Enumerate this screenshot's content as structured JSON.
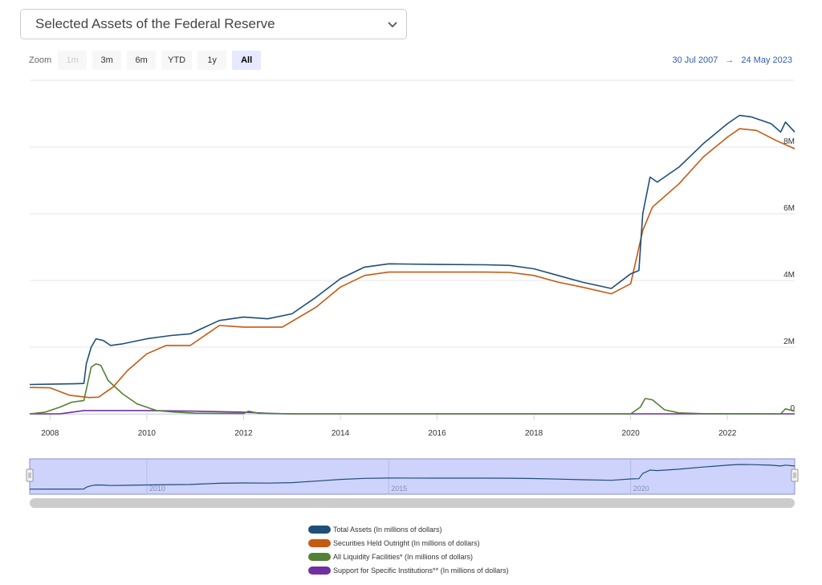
{
  "header": {
    "dropdown_label": "Selected Assets of the Federal Reserve"
  },
  "zoom": {
    "label": "Zoom",
    "buttons": [
      {
        "label": "1m",
        "state": "disabled"
      },
      {
        "label": "3m",
        "state": "normal"
      },
      {
        "label": "6m",
        "state": "normal"
      },
      {
        "label": "YTD",
        "state": "normal"
      },
      {
        "label": "1y",
        "state": "normal"
      },
      {
        "label": "All",
        "state": "active"
      }
    ]
  },
  "range": {
    "from": "30 Jul 2007",
    "arrow": "→",
    "to": "24 May 2023"
  },
  "colors": {
    "total": "#1f4e79",
    "securities": "#c55a11",
    "liquidity": "#538135",
    "support": "#7030a0",
    "navigator_fill": "#cdd3fb",
    "navigator_border": "#8591d6",
    "scrollbar": "#cccccc"
  },
  "chart_data": {
    "type": "line",
    "x_axis": {
      "range": [
        2007.58,
        2023.39
      ],
      "ticks": [
        "2008",
        "2010",
        "2012",
        "2014",
        "2016",
        "2018",
        "2020",
        "2022"
      ]
    },
    "y_axis": {
      "range": [
        0,
        10000000
      ],
      "ticks": [
        "0",
        "2M",
        "4M",
        "6M",
        "8M"
      ]
    },
    "navigator_ticks": [
      "2010",
      "2015",
      "2020"
    ],
    "series": [
      {
        "key": "total",
        "name": "Total Assets (In millions of dollars)",
        "points": [
          [
            2007.58,
            880000
          ],
          [
            2008.0,
            890000
          ],
          [
            2008.5,
            900000
          ],
          [
            2008.7,
            910000
          ],
          [
            2008.75,
            1500000
          ],
          [
            2008.85,
            2000000
          ],
          [
            2008.95,
            2250000
          ],
          [
            2009.1,
            2200000
          ],
          [
            2009.25,
            2050000
          ],
          [
            2009.5,
            2100000
          ],
          [
            2010.0,
            2250000
          ],
          [
            2010.5,
            2350000
          ],
          [
            2010.9,
            2400000
          ],
          [
            2011.5,
            2800000
          ],
          [
            2012.0,
            2900000
          ],
          [
            2012.5,
            2850000
          ],
          [
            2013.0,
            3000000
          ],
          [
            2013.5,
            3500000
          ],
          [
            2014.0,
            4050000
          ],
          [
            2014.5,
            4400000
          ],
          [
            2015.0,
            4500000
          ],
          [
            2016.0,
            4480000
          ],
          [
            2017.0,
            4470000
          ],
          [
            2017.5,
            4450000
          ],
          [
            2018.0,
            4350000
          ],
          [
            2018.5,
            4150000
          ],
          [
            2019.0,
            3950000
          ],
          [
            2019.6,
            3760000
          ],
          [
            2020.0,
            4200000
          ],
          [
            2020.17,
            4300000
          ],
          [
            2020.25,
            6000000
          ],
          [
            2020.4,
            7100000
          ],
          [
            2020.55,
            6950000
          ],
          [
            2021.0,
            7400000
          ],
          [
            2021.5,
            8100000
          ],
          [
            2022.0,
            8700000
          ],
          [
            2022.25,
            8950000
          ],
          [
            2022.5,
            8900000
          ],
          [
            2022.9,
            8700000
          ],
          [
            2023.1,
            8450000
          ],
          [
            2023.2,
            8750000
          ],
          [
            2023.39,
            8450000
          ]
        ]
      },
      {
        "key": "securities",
        "name": "Securities Held Outright (In millions of dollars)",
        "points": [
          [
            2007.58,
            790000
          ],
          [
            2008.0,
            780000
          ],
          [
            2008.4,
            560000
          ],
          [
            2008.8,
            490000
          ],
          [
            2009.0,
            500000
          ],
          [
            2009.3,
            800000
          ],
          [
            2009.6,
            1300000
          ],
          [
            2010.0,
            1800000
          ],
          [
            2010.4,
            2050000
          ],
          [
            2010.9,
            2050000
          ],
          [
            2011.5,
            2650000
          ],
          [
            2012.0,
            2600000
          ],
          [
            2012.8,
            2600000
          ],
          [
            2013.5,
            3200000
          ],
          [
            2014.0,
            3800000
          ],
          [
            2014.5,
            4150000
          ],
          [
            2015.0,
            4250000
          ],
          [
            2016.0,
            4250000
          ],
          [
            2017.0,
            4250000
          ],
          [
            2017.5,
            4240000
          ],
          [
            2018.0,
            4150000
          ],
          [
            2018.5,
            3950000
          ],
          [
            2019.0,
            3800000
          ],
          [
            2019.6,
            3600000
          ],
          [
            2020.0,
            3900000
          ],
          [
            2020.25,
            5500000
          ],
          [
            2020.45,
            6200000
          ],
          [
            2021.0,
            6900000
          ],
          [
            2021.5,
            7700000
          ],
          [
            2022.0,
            8300000
          ],
          [
            2022.25,
            8550000
          ],
          [
            2022.6,
            8500000
          ],
          [
            2023.0,
            8200000
          ],
          [
            2023.39,
            7950000
          ]
        ]
      },
      {
        "key": "liquidity",
        "name": "All Liquidity Facilities* (In millions of dollars)",
        "points": [
          [
            2007.58,
            0
          ],
          [
            2007.9,
            50000
          ],
          [
            2008.2,
            200000
          ],
          [
            2008.45,
            350000
          ],
          [
            2008.7,
            400000
          ],
          [
            2008.85,
            1400000
          ],
          [
            2008.95,
            1500000
          ],
          [
            2009.05,
            1450000
          ],
          [
            2009.2,
            1000000
          ],
          [
            2009.5,
            600000
          ],
          [
            2009.8,
            300000
          ],
          [
            2010.2,
            100000
          ],
          [
            2010.6,
            50000
          ],
          [
            2011.0,
            20000
          ],
          [
            2012.0,
            10000
          ],
          [
            2012.1,
            80000
          ],
          [
            2012.3,
            20000
          ],
          [
            2013.0,
            0
          ],
          [
            2020.0,
            0
          ],
          [
            2020.2,
            200000
          ],
          [
            2020.3,
            460000
          ],
          [
            2020.45,
            420000
          ],
          [
            2020.7,
            120000
          ],
          [
            2021.0,
            30000
          ],
          [
            2021.5,
            5000
          ],
          [
            2023.1,
            0
          ],
          [
            2023.2,
            150000
          ],
          [
            2023.39,
            80000
          ]
        ]
      },
      {
        "key": "support",
        "name": "Support for Specific Institutions** (In millions of dollars)",
        "points": [
          [
            2007.58,
            0
          ],
          [
            2008.2,
            0
          ],
          [
            2008.35,
            30000
          ],
          [
            2008.7,
            100000
          ],
          [
            2010.0,
            100000
          ],
          [
            2010.5,
            90000
          ],
          [
            2011.0,
            80000
          ],
          [
            2012.0,
            50000
          ],
          [
            2012.6,
            10000
          ],
          [
            2013.0,
            0
          ],
          [
            2023.39,
            0
          ]
        ]
      }
    ]
  }
}
